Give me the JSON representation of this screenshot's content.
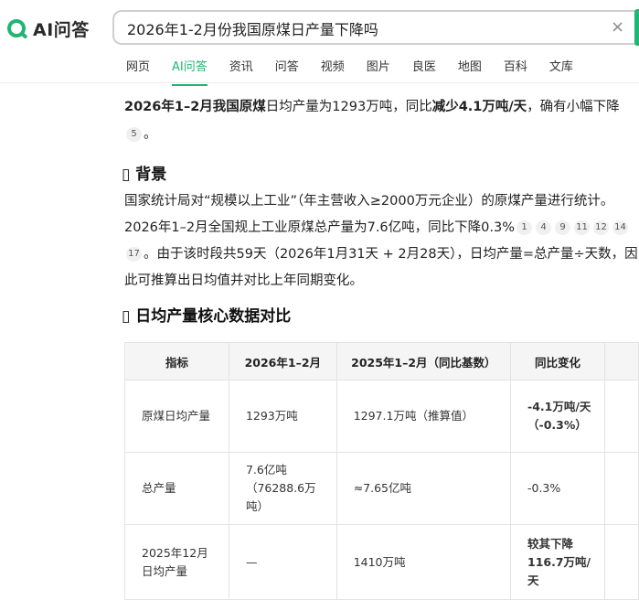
{
  "header": {
    "logo_text": "AI问答",
    "search_value": "2026年1-2月份我国原煤日产量下降吗",
    "clear_glyph": "×"
  },
  "tabs": [
    "网页",
    "AI问答",
    "资讯",
    "问答",
    "视频",
    "图片",
    "良医",
    "地图",
    "百科",
    "文库"
  ],
  "tab_partial": "",
  "active_tab": "AI问答",
  "colors": {
    "brand": "#21b573",
    "text": "#222222",
    "cite_bg": "#f0f0f0",
    "table_header_bg": "#f5f5f5"
  },
  "answer": {
    "p1_b1": "2026年1–2月我国原煤",
    "p1_t1": "日均产量为1293万吨，同比",
    "p1_b2": "减少4.1万吨/天",
    "p1_t2": "，确有小幅下降",
    "p1_cite": "5",
    "p1_end": "。",
    "section1_icon": "▯",
    "section1_title": "背景",
    "p2_t1": "国家统计局对“规模以上工业”（年主营收入≥2000万元企业）的原煤产量进行统计。2026年1–2月全国规上工业原煤总产量为7.6亿吨，同比下降0.3%",
    "p2_cites1": [
      "1",
      "4",
      "9",
      "11",
      "12",
      "14",
      "17"
    ],
    "p2_t2": "。由于该时段共59天（2026年1月31天 + 2月28天），日均产量=总产量÷天数，因此可推算出日均值并对比上年同期变化。",
    "section2_icon": "▯",
    "section2_title": "日均产量核心数据对比"
  },
  "table": {
    "headers": [
      "指标",
      "2026年1–2月",
      "2025年1–2月（同比基数）",
      "同比变化"
    ],
    "rows": [
      [
        "原煤日均产量",
        "1293万吨",
        "1297.1万吨（推算值）",
        "-4.1万吨/天（-0.3%）"
      ],
      [
        "总产量",
        "7.6亿吨（76288.6万吨）",
        "≈7.65亿吨",
        "-0.3%"
      ],
      [
        "2025年12月日均产量",
        "—",
        "1410万吨",
        "较其下降116.7万吨/天"
      ]
    ]
  }
}
